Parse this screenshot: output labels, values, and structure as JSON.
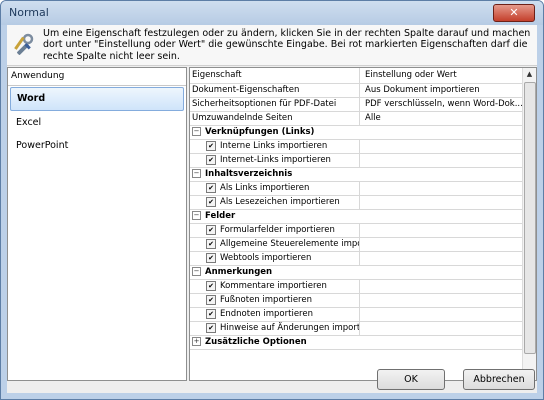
{
  "window": {
    "title": "Normal"
  },
  "info": {
    "text": "Um eine Eigenschaft festzulegen oder zu ändern, klicken Sie in der rechten Spalte darauf und machen dort unter \"Einstellung oder Wert\" die gewünschte Eingabe. Bei rot markierten Eigenschaften darf die rechte Spalte nicht leer sein."
  },
  "left_panel": {
    "header": "Anwendung",
    "items": [
      {
        "label": "Word"
      },
      {
        "label": "Excel"
      },
      {
        "label": "PowerPoint"
      }
    ]
  },
  "grid": {
    "headers": {
      "property": "Eigenschaft",
      "value": "Einstellung oder Wert"
    },
    "rows": [
      {
        "kind": "plain",
        "label": "Dokument-Eigenschaften",
        "value": "Aus Dokument importieren"
      },
      {
        "kind": "plain",
        "label": "Sicherheitsoptionen für PDF-Datei",
        "value": "PDF verschlüsseln, wenn Word-Dok..."
      },
      {
        "kind": "plain",
        "label": "Umzuwandelnde Seiten",
        "value": "Alle"
      },
      {
        "kind": "cat",
        "label": "Verknüpfungen (Links)",
        "exp": "−"
      },
      {
        "kind": "check",
        "label": "Interne Links importieren",
        "value": ""
      },
      {
        "kind": "check",
        "label": "Internet-Links importieren",
        "value": ""
      },
      {
        "kind": "cat",
        "label": "Inhaltsverzeichnis",
        "exp": "−"
      },
      {
        "kind": "check",
        "label": "Als Links importieren",
        "value": ""
      },
      {
        "kind": "check",
        "label": "Als Lesezeichen importieren",
        "value": ""
      },
      {
        "kind": "cat",
        "label": "Felder",
        "exp": "−"
      },
      {
        "kind": "check",
        "label": "Formularfelder importieren",
        "value": ""
      },
      {
        "kind": "check",
        "label": "Allgemeine Steuerelemente impo...",
        "value": ""
      },
      {
        "kind": "check",
        "label": "Webtools importieren",
        "value": ""
      },
      {
        "kind": "cat",
        "label": "Anmerkungen",
        "exp": "−"
      },
      {
        "kind": "check",
        "label": "Kommentare importieren",
        "value": ""
      },
      {
        "kind": "check",
        "label": "Fußnoten importieren",
        "value": ""
      },
      {
        "kind": "check",
        "label": "Endnoten importieren",
        "value": ""
      },
      {
        "kind": "check",
        "label": "Hinweise auf Änderungen importi...",
        "value": ""
      },
      {
        "kind": "cat",
        "label": "Zusätzliche Optionen",
        "exp": "+"
      }
    ],
    "check_mark": "✔"
  },
  "buttons": {
    "ok": "OK",
    "cancel": "Abbrechen"
  },
  "icons": {
    "close": "✕",
    "scroll_up": "▲",
    "scroll_down": "▼"
  }
}
